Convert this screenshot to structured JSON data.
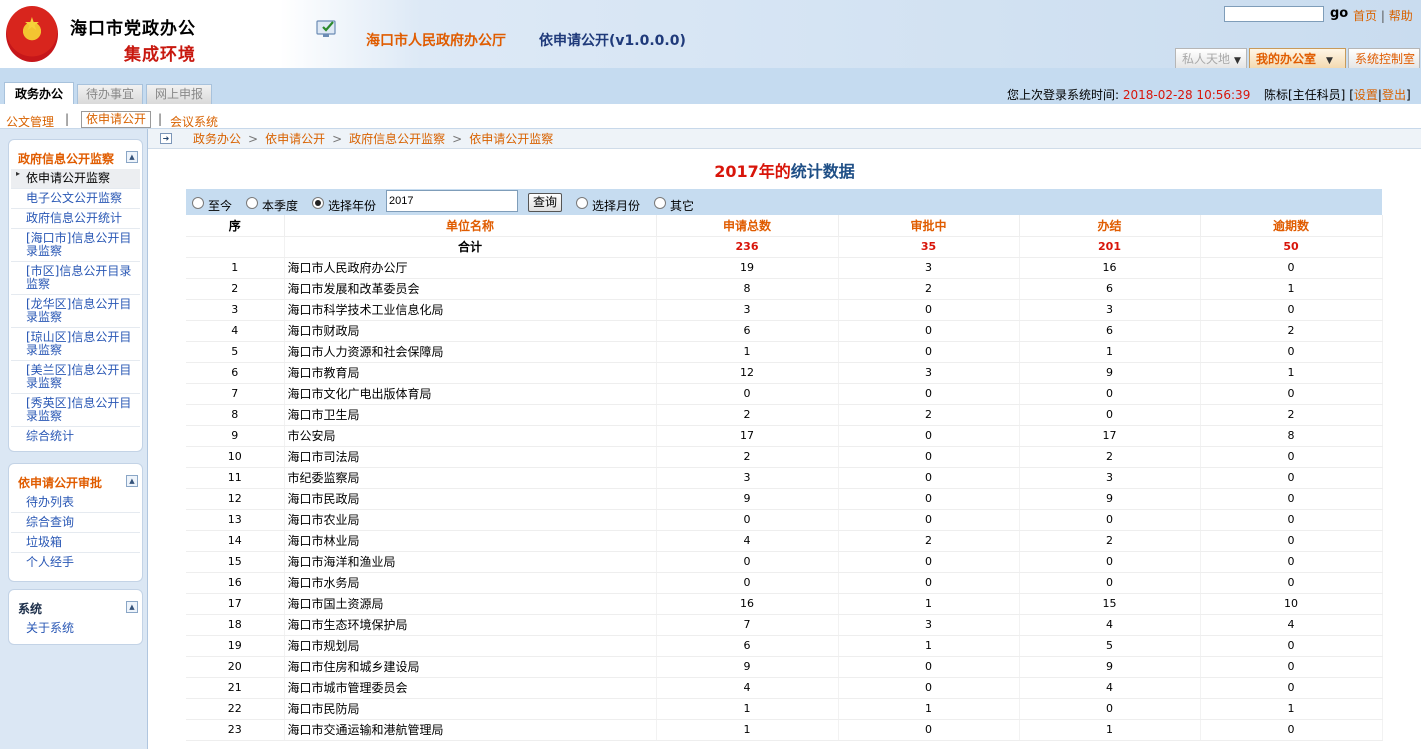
{
  "header": {
    "system_name": "海口市党政办公",
    "system_sub": "集成环境",
    "office_name": "海口市人民政府办公厅",
    "app_name": "依申请公开(v1.0.0.0)",
    "search_value": "",
    "go_label": "go",
    "top_links": [
      "首页",
      "帮助"
    ],
    "menus": [
      {
        "label": "私人天地",
        "has_dropdown": true
      },
      {
        "label": "我的办公室",
        "has_dropdown": true
      },
      {
        "label": "系统控制室",
        "has_dropdown": false
      }
    ]
  },
  "tabs": {
    "main": [
      "政务办公",
      "待办事宜",
      "网上申报"
    ],
    "active": "政务办公",
    "login_label": "您上次登录系统时间:",
    "login_time": "2018-02-28 10:56:39",
    "user_name": "陈标[主任科员]",
    "user_links": [
      "设置",
      "登出"
    ]
  },
  "subnav": {
    "items": [
      "公文管理",
      "依申请公开",
      "会议系统"
    ],
    "active": "依申请公开"
  },
  "sidebar": {
    "panels": [
      {
        "title": "政府信息公开监察",
        "items": [
          "依申请公开监察",
          "电子公文公开监察",
          "政府信息公开统计",
          "[海口市]信息公开目录监察",
          "[市区]信息公开目录监察",
          "[龙华区]信息公开目录监察",
          "[琼山区]信息公开目录监察",
          "[美兰区]信息公开目录监察",
          "[秀英区]信息公开目录监察",
          "综合统计"
        ]
      },
      {
        "title": "依申请公开审批",
        "items": [
          "待办列表",
          "综合查询",
          "垃圾箱",
          "个人经手"
        ]
      },
      {
        "title": "系统",
        "items": [
          "关于系统"
        ]
      }
    ]
  },
  "breadcrumb": [
    "政务办公",
    "依申请公开",
    "政府信息公开监察",
    "依申请公开监察"
  ],
  "page": {
    "title_year": "2017年的",
    "title_rest": "统计数据"
  },
  "filters": {
    "options": [
      "至今",
      "本季度",
      "选择年份",
      "选择月份",
      "其它"
    ],
    "selected": "选择年份",
    "year_value": "2017",
    "query_label": "查询"
  },
  "table": {
    "headers": [
      "序",
      "单位名称",
      "申请总数",
      "审批中",
      "办结",
      "逾期数"
    ],
    "total": {
      "label": "合计",
      "total": "236",
      "pending": "35",
      "done": "201",
      "overdue": "50"
    },
    "rows": [
      [
        "1",
        "海口市人民政府办公厅",
        "19",
        "3",
        "16",
        "0"
      ],
      [
        "2",
        "海口市发展和改革委员会",
        "8",
        "2",
        "6",
        "1"
      ],
      [
        "3",
        "海口市科学技术工业信息化局",
        "3",
        "0",
        "3",
        "0"
      ],
      [
        "4",
        "海口市财政局",
        "6",
        "0",
        "6",
        "2"
      ],
      [
        "5",
        "海口市人力资源和社会保障局",
        "1",
        "0",
        "1",
        "0"
      ],
      [
        "6",
        "海口市教育局",
        "12",
        "3",
        "9",
        "1"
      ],
      [
        "7",
        "海口市文化广电出版体育局",
        "0",
        "0",
        "0",
        "0"
      ],
      [
        "8",
        "海口市卫生局",
        "2",
        "2",
        "0",
        "2"
      ],
      [
        "9",
        "市公安局",
        "17",
        "0",
        "17",
        "8"
      ],
      [
        "10",
        "海口市司法局",
        "2",
        "0",
        "2",
        "0"
      ],
      [
        "11",
        "市纪委监察局",
        "3",
        "0",
        "3",
        "0"
      ],
      [
        "12",
        "海口市民政局",
        "9",
        "0",
        "9",
        "0"
      ],
      [
        "13",
        "海口市农业局",
        "0",
        "0",
        "0",
        "0"
      ],
      [
        "14",
        "海口市林业局",
        "4",
        "2",
        "2",
        "0"
      ],
      [
        "15",
        "海口市海洋和渔业局",
        "0",
        "0",
        "0",
        "0"
      ],
      [
        "16",
        "海口市水务局",
        "0",
        "0",
        "0",
        "0"
      ],
      [
        "17",
        "海口市国土资源局",
        "16",
        "1",
        "15",
        "10"
      ],
      [
        "18",
        "海口市生态环境保护局",
        "7",
        "3",
        "4",
        "4"
      ],
      [
        "19",
        "海口市规划局",
        "6",
        "1",
        "5",
        "0"
      ],
      [
        "20",
        "海口市住房和城乡建设局",
        "9",
        "0",
        "9",
        "0"
      ],
      [
        "21",
        "海口市城市管理委员会",
        "4",
        "0",
        "4",
        "0"
      ],
      [
        "22",
        "海口市民防局",
        "1",
        "1",
        "0",
        "1"
      ],
      [
        "23",
        "海口市交通运输和港航管理局",
        "1",
        "0",
        "1",
        "0"
      ]
    ]
  }
}
